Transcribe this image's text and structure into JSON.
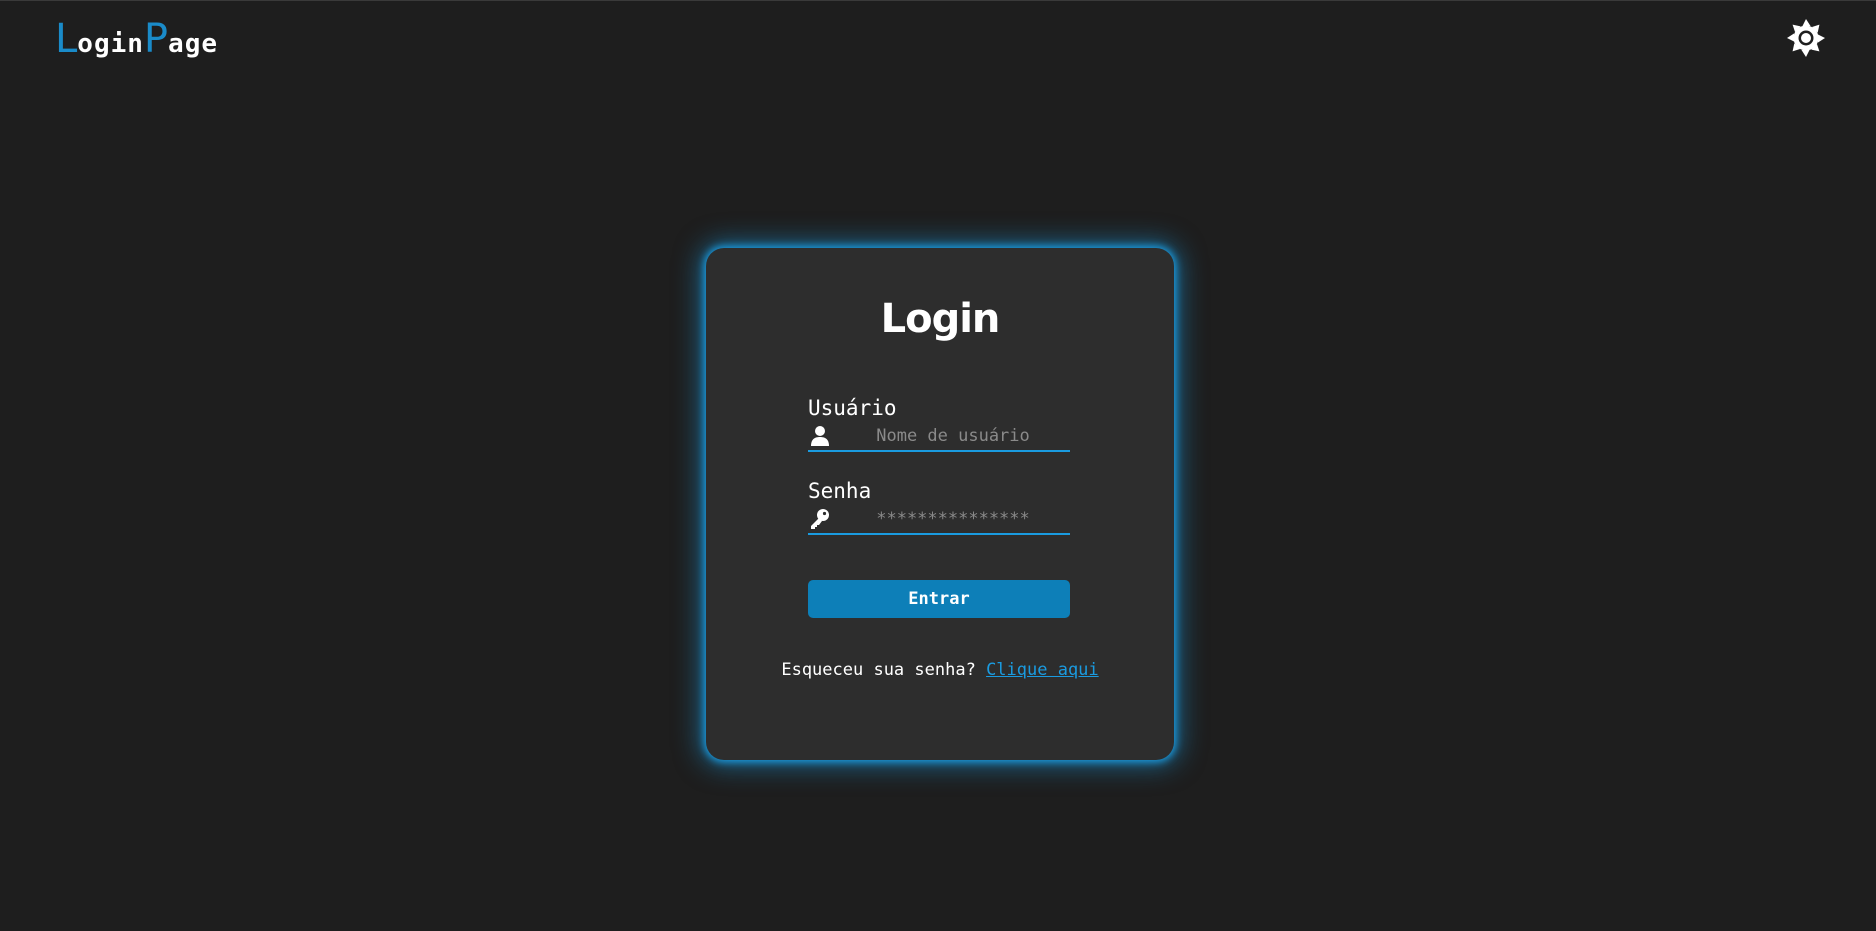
{
  "header": {
    "logo": {
      "part1_initial": "L",
      "part1_rest": "ogin",
      "part2_initial": "P",
      "part2_rest": "age"
    },
    "theme_toggle_icon": "sun-icon"
  },
  "login_card": {
    "title": "Login",
    "username": {
      "label": "Usuário",
      "placeholder": "Nome de usuário",
      "value": "",
      "icon": "user-icon"
    },
    "password": {
      "label": "Senha",
      "placeholder": "***************",
      "value": "",
      "icon": "key-icon"
    },
    "submit_label": "Entrar",
    "forgot": {
      "text": "Esqueceu sua senha?",
      "link_label": "Clique aqui"
    }
  },
  "colors": {
    "background": "#1e1e1e",
    "card": "#2d2d2d",
    "accent": "#1a9be0",
    "button": "#0d7fb8",
    "logo_accent": "#1a8bc9"
  }
}
